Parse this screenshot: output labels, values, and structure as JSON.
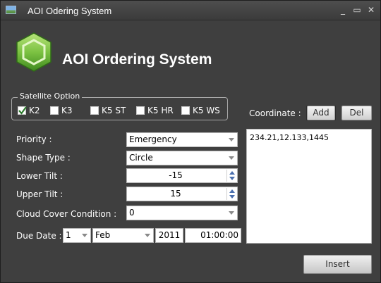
{
  "window": {
    "title": "AOI Odering System",
    "minimize_glyph": "_",
    "maximize_glyph": "▭",
    "close_glyph": "✕"
  },
  "header": {
    "app_title": "AOI Ordering System",
    "logo_icon": "green-hexagon-logo"
  },
  "satellite": {
    "legend": "Satellite Option",
    "options": [
      {
        "label": "K2",
        "checked": true
      },
      {
        "label": "K3",
        "checked": false
      },
      {
        "label": "K5 ST",
        "checked": false
      },
      {
        "label": "K5 HR",
        "checked": false
      },
      {
        "label": "K5 WS",
        "checked": false
      }
    ]
  },
  "form": {
    "priority_label": "Priority :",
    "priority_value": "Emergency",
    "shape_label": "Shape Type :",
    "shape_value": "Circle",
    "lower_tilt_label": "Lower Tilt :",
    "lower_tilt_value": "-15",
    "upper_tilt_label": "Upper Tilt :",
    "upper_tilt_value": "15",
    "cloud_label": "Cloud Cover Condition :",
    "cloud_value": "0",
    "due_label": "Due Date :",
    "due_day": "1",
    "due_month": "Feb",
    "due_year": "2011",
    "due_time": "01:00:00"
  },
  "coordinate": {
    "label": "Coordinate :",
    "add_label": "Add",
    "del_label": "Del",
    "text": "234.21,12.133,1445"
  },
  "footer": {
    "insert_label": "Insert"
  },
  "colors": {
    "background": "#3f3f3f",
    "titlebar": "#4e4e4e",
    "spin_arrow": "#4a6fae",
    "logo_green": "#7cc242"
  }
}
